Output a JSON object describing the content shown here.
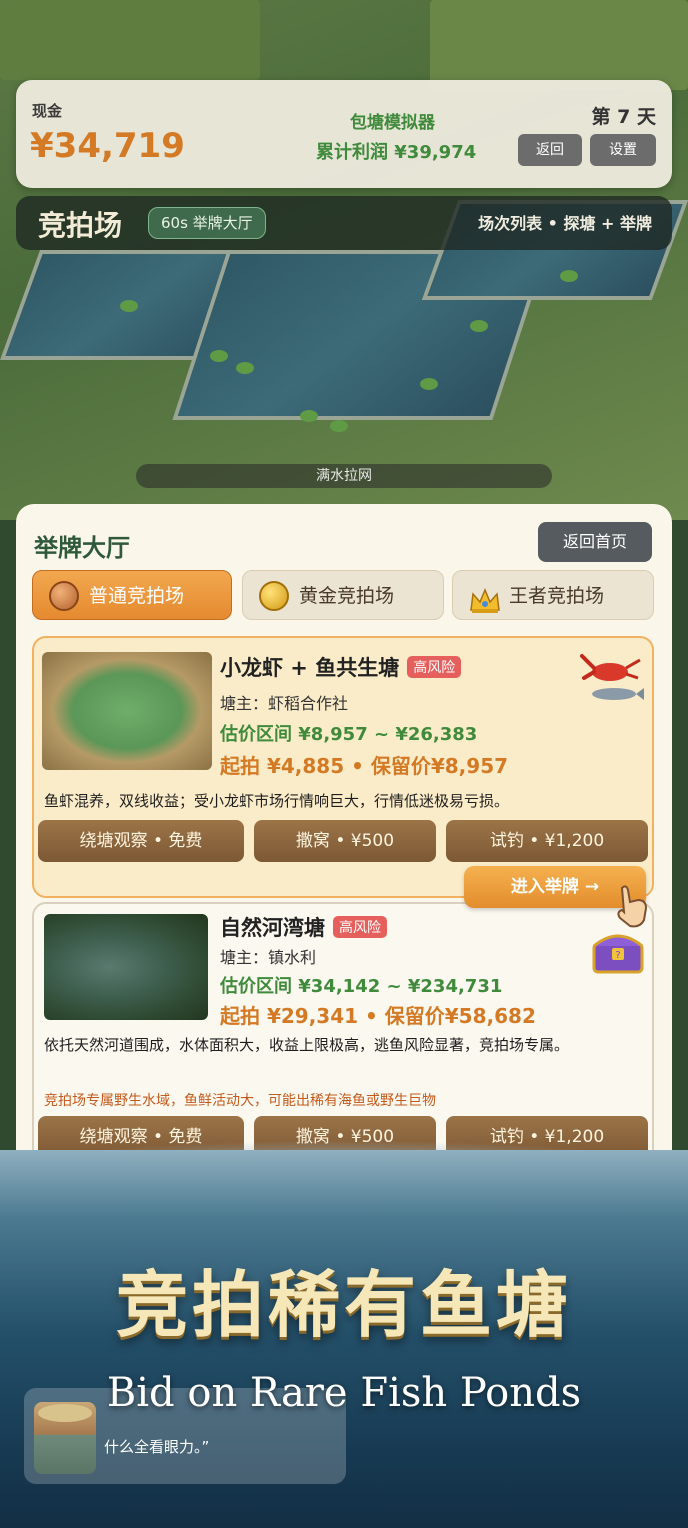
{
  "status": {
    "cash_label": "现金",
    "cash_value": "¥34,719",
    "app_title": "包塘模拟器",
    "profit": "累计利润 ¥39,974",
    "day": "第 7 天",
    "back_label": "返回",
    "settings_label": "设置"
  },
  "auction_bar": {
    "title": "竞拍场",
    "badge": "60s 举牌大厅",
    "nav": "场次列表 • 探塘 + 举牌"
  },
  "scene": {
    "drain_label": "满水拉网"
  },
  "panel": {
    "title": "举牌大厅",
    "home_button": "返回首页",
    "tabs": [
      {
        "label": "普通竞拍场",
        "icon": "bronze-coin-icon",
        "active": true
      },
      {
        "label": "黄金竞拍场",
        "icon": "gold-coin-icon",
        "active": false
      },
      {
        "label": "王者竞拍场",
        "icon": "crown-icon",
        "active": false
      }
    ]
  },
  "ponds": [
    {
      "name": "小龙虾 + 鱼共生塘",
      "risk": "高风险",
      "owner": "塘主：虾稻合作社",
      "estimate": "估价区间 ¥8,957 ~ ¥26,383",
      "bid": "起拍 ¥4,885 • 保留价¥8,957",
      "desc": "鱼虾混养，双线收益；受小龙虾市场行情响巨大，行情低迷极易亏损。",
      "note": "",
      "icon": "crayfish-icon",
      "actions": [
        "绕塘观察 • 免费",
        "撒窝 • ¥500",
        "试钓 • ¥1,200"
      ],
      "enter": "进入举牌 →"
    },
    {
      "name": "自然河湾塘",
      "risk": "高风险",
      "owner": "塘主：镇水利",
      "estimate": "估价区间 ¥34,142 ~ ¥234,731",
      "bid": "起拍 ¥29,341 • 保留价¥58,682",
      "desc": "依托天然河道围成，水体面积大，收益上限极高，逃鱼风险显著，竞拍场专属。",
      "note": "竞拍场专属野生水域，鱼鲜活动大，可能出稀有海鱼或野生巨物",
      "icon": "treasure-chest-icon",
      "actions": [
        "绕塘观察 • 免费",
        "撒窝 • ¥500",
        "试钓 • ¥1,200"
      ]
    }
  ],
  "promo": {
    "title_cn": "竞拍稀有鱼塘",
    "title_en": "Bid on Rare Fish Ponds",
    "dialog_text": "什么全看眼力。”"
  },
  "colors": {
    "accent_orange": "#e58a30",
    "profit_green": "#3f8a3b",
    "risk_red": "#e5605c"
  }
}
